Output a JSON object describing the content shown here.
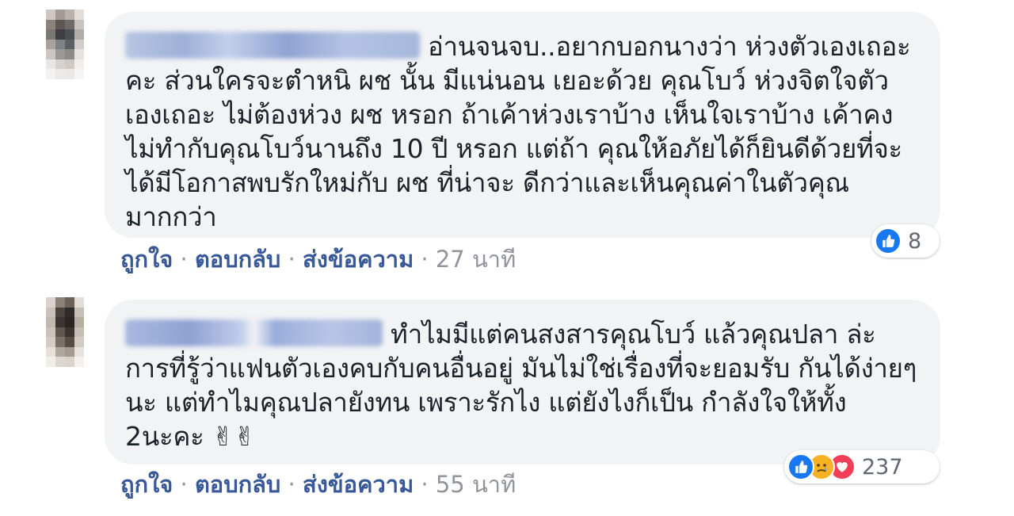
{
  "comments": [
    {
      "author": "████████ ████████",
      "text": "อ่านจนจบ..อยากบอกนางว่า ห่วงตัวเองเถอะคะ ส่วนใครจะตำหนิ ผช นั้น มีแน่นอน เยอะด้วย คุณโบว์ ห่วงจิตใจตัวเองเถอะ ไม่ต้องห่วง ผช หรอก ถ้าเค้าห่วงเราบ้าง เห็นใจเราบ้าง เค้าคงไม่ทำกับคุณโบว์นานถึง 10 ปี หรอก แต่ถ้า คุณให้อภัยได้ก็ยินดีด้วยที่จะได้มีโอกาสพบรักใหม่กับ ผช ที่น่าจะ ดีกว่าและเห็นคุณค่าในตัวคุณมากกว่า",
      "actions": {
        "like": "ถูกใจ",
        "reply": "ตอบกลับ",
        "message": "ส่งข้อความ",
        "sep": "·",
        "time": "27 นาที"
      },
      "reactions": {
        "icons": [
          "like-icon"
        ],
        "count": "8"
      }
    },
    {
      "author": "████████ ██████",
      "text": "ทำไมมีแต่คนสงสารคุณโบว์ แล้วคุณปลา ล่ะ การที่รู้ว่าแฟนตัวเองคบกับคนอื่นอยู่ มันไม่ใช่เรื่องที่จะยอมรับ กันได้ง่ายๆนะ แต่ทำไมคุณปลายังทน เพราะรักไง แต่ยังไงก็เป็น กำลังใจให้ทั้ง 2นะคะ ✌✌",
      "actions": {
        "like": "ถูกใจ",
        "reply": "ตอบกลับ",
        "message": "ส่งข้อความ",
        "sep": "·",
        "time": "55 นาที"
      },
      "reactions": {
        "icons": [
          "like-icon",
          "sad-icon",
          "love-icon"
        ],
        "count": "237"
      }
    }
  ],
  "colors": {
    "link": "#385898",
    "meta": "#90949c",
    "bubble": "#f2f3f5",
    "like": "#1877f2",
    "love": "#f33e58",
    "sad": "#f7b125"
  }
}
